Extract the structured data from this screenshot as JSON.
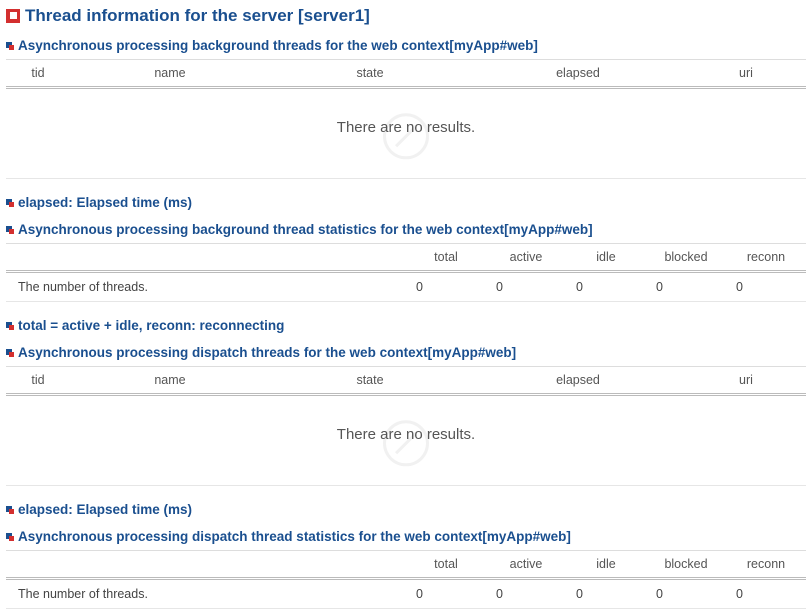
{
  "page": {
    "title": "Thread information for the server [server1]"
  },
  "sections": {
    "bgThreads": {
      "heading": "Asynchronous processing background threads for the web context[myApp#web]",
      "columns": {
        "tid": "tid",
        "name": "name",
        "state": "state",
        "elapsed": "elapsed",
        "uri": "uri"
      },
      "empty": "There are no results."
    },
    "elapsedNote1": "elapsed: Elapsed time (ms)",
    "bgStats": {
      "heading": "Asynchronous processing background thread statistics for the web context[myApp#web]",
      "columns": {
        "total": "total",
        "active": "active",
        "idle": "idle",
        "blocked": "blocked",
        "reconn": "reconn"
      },
      "row": {
        "label": "The number of threads.",
        "total": "0",
        "active": "0",
        "idle": "0",
        "blocked": "0",
        "reconn": "0"
      }
    },
    "totalNote": "total = active + idle, reconn: reconnecting",
    "dispThreads": {
      "heading": "Asynchronous processing dispatch threads for the web context[myApp#web]",
      "columns": {
        "tid": "tid",
        "name": "name",
        "state": "state",
        "elapsed": "elapsed",
        "uri": "uri"
      },
      "empty": "There are no results."
    },
    "elapsedNote2": "elapsed: Elapsed time (ms)",
    "dispStats": {
      "heading": "Asynchronous processing dispatch thread statistics for the web context[myApp#web]",
      "columns": {
        "total": "total",
        "active": "active",
        "idle": "idle",
        "blocked": "blocked",
        "reconn": "reconn"
      },
      "row": {
        "label": "The number of threads.",
        "total": "0",
        "active": "0",
        "idle": "0",
        "blocked": "0",
        "reconn": "0"
      }
    }
  }
}
